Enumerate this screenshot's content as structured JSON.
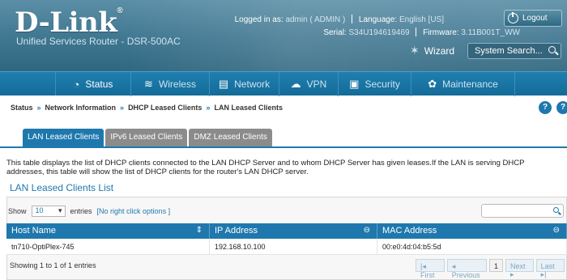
{
  "header": {
    "brand": "D-Link",
    "product": "Unified Services Router - DSR-500AC",
    "logged_label": "Logged in as:",
    "logged_value": "admin ( ADMIN )",
    "language_label": "Language:",
    "language_value": "English [US]",
    "serial_label": "Serial:",
    "serial_value": "S34U194619469",
    "firmware_label": "Firmware:",
    "firmware_value": "3.11B001T_WW",
    "logout": "Logout",
    "wizard": "Wizard",
    "search_placeholder": "System Search..."
  },
  "nav": [
    {
      "label": "Status",
      "icon": "dashboard-icon"
    },
    {
      "label": "Wireless",
      "icon": "wifi-icon"
    },
    {
      "label": "Network",
      "icon": "network-icon"
    },
    {
      "label": "VPN",
      "icon": "vpn-cloud-icon"
    },
    {
      "label": "Security",
      "icon": "lock-icon"
    },
    {
      "label": "Maintenance",
      "icon": "gears-icon"
    }
  ],
  "breadcrumb": [
    "Status",
    "Network Information",
    "DHCP Leased Clients",
    "LAN Leased Clients"
  ],
  "breadcrumb_sep": "»",
  "help": [
    "?",
    "?"
  ],
  "tabs": [
    "LAN Leased Clients",
    "IPv6 Leased Clients",
    "DMZ Leased Clients"
  ],
  "description": "This table displays the list of DHCP clients connected to the LAN DHCP Server and to whom DHCP Server has given leases.If the LAN is serving DHCP addresses, this table will show the list of DHCP clients for the router's LAN DHCP server.",
  "list_title": "LAN Leased Clients List",
  "table": {
    "show_label": "Show",
    "show_value": "10",
    "entries_label": "entries",
    "no_right_click": "[No right click options ]",
    "columns": [
      "Host Name",
      "IP Address",
      "MAC Address"
    ],
    "rows": [
      [
        "tn710-OptiPlex-745",
        "192.168.10.100",
        "00:e0:4d:04:b5:5d"
      ]
    ],
    "showing": "Showing 1 to 1 of 1 entries",
    "pager": [
      "First",
      "Previous",
      "1",
      "Next",
      "Last"
    ]
  },
  "colors": {
    "accent": "#1f78ad",
    "header": "#3f7690"
  }
}
